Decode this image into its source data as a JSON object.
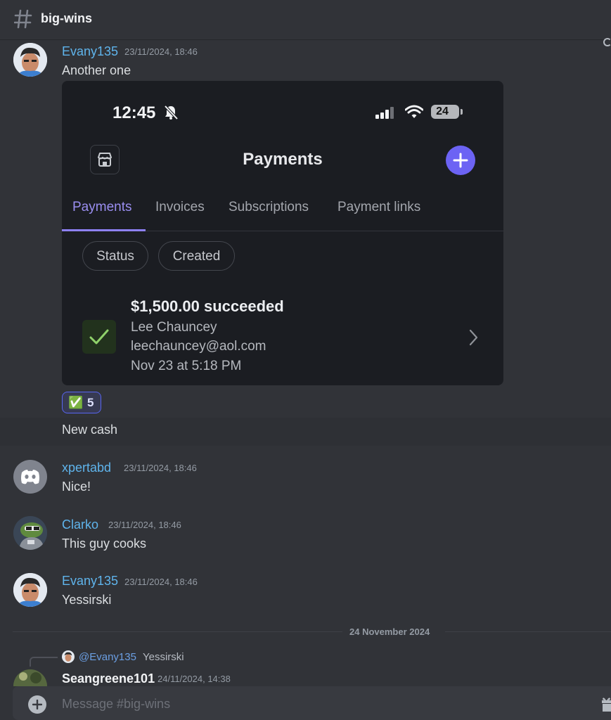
{
  "channel": {
    "name": "big-wins"
  },
  "messages": [
    {
      "author": "Evany135",
      "timestamp": "23/11/2024, 18:46",
      "text": "Another one"
    },
    {
      "text": "New cash"
    },
    {
      "author": "xpertabd",
      "timestamp": "23/11/2024, 18:46",
      "text": "Nice!"
    },
    {
      "author": "Clarko",
      "timestamp": "23/11/2024, 18:46",
      "text": "This guy cooks"
    },
    {
      "author": "Evany135",
      "timestamp": "23/11/2024, 18:46",
      "text": "Yessirski"
    }
  ],
  "attachment": {
    "status_time": "12:45",
    "battery": "24",
    "title": "Payments",
    "tabs": [
      "Payments",
      "Invoices",
      "Subscriptions",
      "Payment links"
    ],
    "filters": [
      "Status",
      "Created"
    ],
    "payment": {
      "amount_status": "$1,500.00 succeeded",
      "name": "Lee Chauncey",
      "email": "leechauncey@aol.com",
      "date": "Nov 23 at 5:18 PM"
    }
  },
  "reaction": {
    "emoji": "✅",
    "count": "5"
  },
  "date_divider": "24 November 2024",
  "reply": {
    "mention": "@Evany135",
    "preview": "Yessirski",
    "author": "Seangreene101",
    "timestamp": "24/11/2024, 14:38"
  },
  "composer": {
    "placeholder": "Message #big-wins"
  },
  "colors": {
    "background": "#313338",
    "author_blue": "#5fb4ec",
    "accent": "#5865f2",
    "phone_accent": "#9a8ef0"
  }
}
